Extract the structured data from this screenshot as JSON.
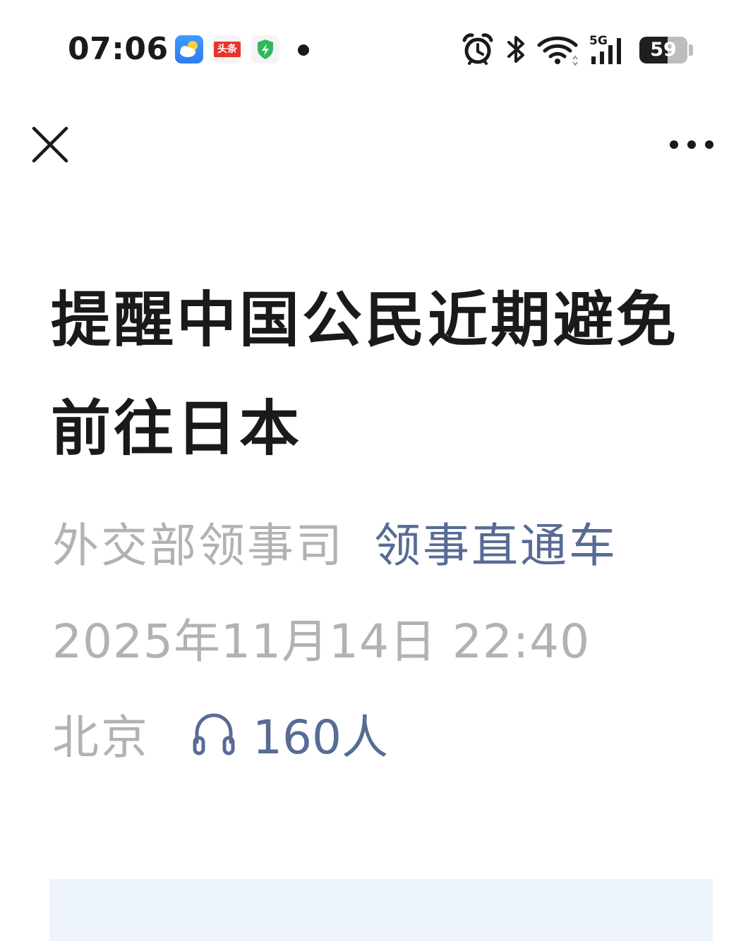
{
  "status_bar": {
    "time": "07:06",
    "notification_icons": [
      "weather-icon",
      "toutiao-icon",
      "security-shield-icon"
    ],
    "toutiao_label": "头条",
    "system_icons": [
      "alarm-icon",
      "bluetooth-icon",
      "wifi-icon",
      "5g-signal-icon"
    ],
    "network_label": "5G",
    "battery_level": "59",
    "battery_fraction": 0.59
  },
  "nav": {
    "close_icon": "close-icon",
    "more_icon": "more-dots-icon"
  },
  "article": {
    "title": "提醒中国公民近期避免前往日本",
    "author": "外交部领事司",
    "account": "领事直通车",
    "datetime": "2025年11月14日 22:40",
    "location": "北京",
    "listen_icon": "headphones-icon",
    "listen_count": "160人"
  },
  "colors": {
    "title": "#1a1a1a",
    "meta_gray": "#b2b2b2",
    "link_blue": "#576b95",
    "panel_bg": "#eef4fc"
  }
}
